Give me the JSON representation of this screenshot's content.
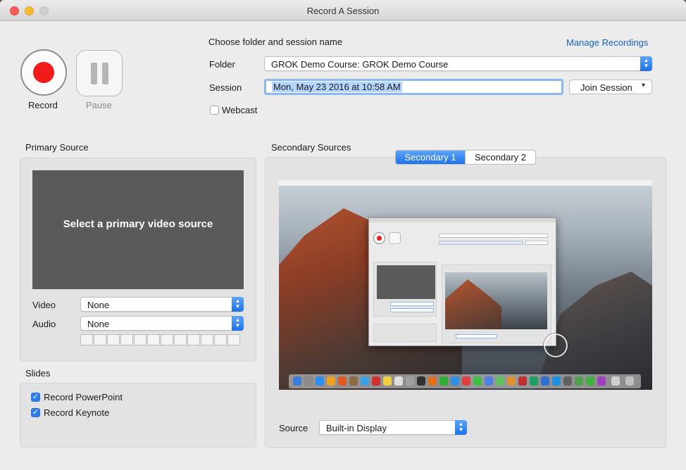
{
  "window": {
    "title": "Record A Session"
  },
  "controls": {
    "record_label": "Record",
    "pause_label": "Pause"
  },
  "session": {
    "heading": "Choose folder and session name",
    "manage_link": "Manage Recordings",
    "folder_label": "Folder",
    "folder_value": "GROK Demo Course: GROK Demo Course",
    "session_label": "Session",
    "session_value": "Mon, May 23 2016 at 10:58 AM",
    "join_label": "Join Session",
    "webcast_label": "Webcast",
    "webcast_checked": false
  },
  "primary": {
    "heading": "Primary Source",
    "placeholder": "Select a primary video source",
    "video_label": "Video",
    "video_value": "None",
    "audio_label": "Audio",
    "audio_value": "None"
  },
  "slides": {
    "heading": "Slides",
    "items": [
      {
        "label": "Record PowerPoint",
        "checked": true
      },
      {
        "label": "Record Keynote",
        "checked": true
      }
    ]
  },
  "secondary": {
    "heading": "Secondary Sources",
    "tabs": [
      "Secondary 1",
      "Secondary 2"
    ],
    "active_tab": "Secondary 1",
    "source_label": "Source",
    "source_value": "Built-in Display"
  },
  "colors": {
    "accent": "#1f72e8",
    "record": "#f21b1b",
    "link": "#1761c7"
  }
}
